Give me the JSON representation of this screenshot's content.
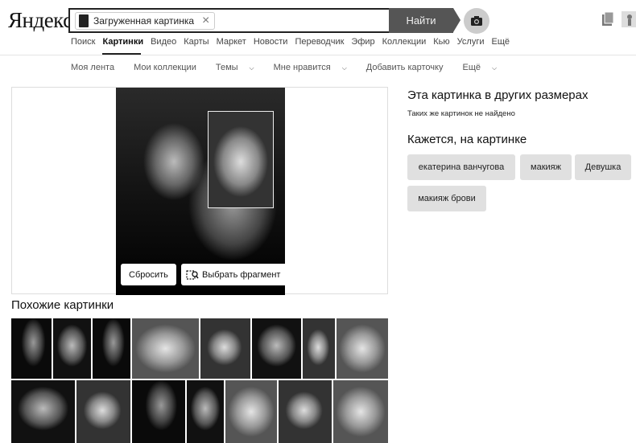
{
  "header": {
    "logo": "Яндекс",
    "search_chip": "Загруженная картинка",
    "search_button": "Найти"
  },
  "tabs": [
    "Поиск",
    "Картинки",
    "Видео",
    "Карты",
    "Маркет",
    "Новости",
    "Переводчик",
    "Эфир",
    "Коллекции",
    "Кью",
    "Услуги",
    "Ещё"
  ],
  "active_tab": "Картинки",
  "subnav": [
    {
      "label": "Моя лента",
      "dropdown": false
    },
    {
      "label": "Мои коллекции",
      "dropdown": false
    },
    {
      "label": "Темы",
      "dropdown": true
    },
    {
      "label": "Мне нравится",
      "dropdown": true
    },
    {
      "label": "Добавить карточку",
      "dropdown": false
    },
    {
      "label": "Ещё",
      "dropdown": true
    }
  ],
  "preview": {
    "reset_button": "Сбросить",
    "select_fragment_button": "Выбрать фрагмент"
  },
  "right": {
    "sizes_title": "Эта картинка в других размерах",
    "sizes_note": "Таких же картинок не найдено",
    "tags_title": "Кажется, на картинке",
    "tags": [
      "екатерина ванчугова",
      "макияж",
      "Девушка",
      "макияж брови"
    ]
  },
  "similar": {
    "title": "Похожие картинки"
  }
}
